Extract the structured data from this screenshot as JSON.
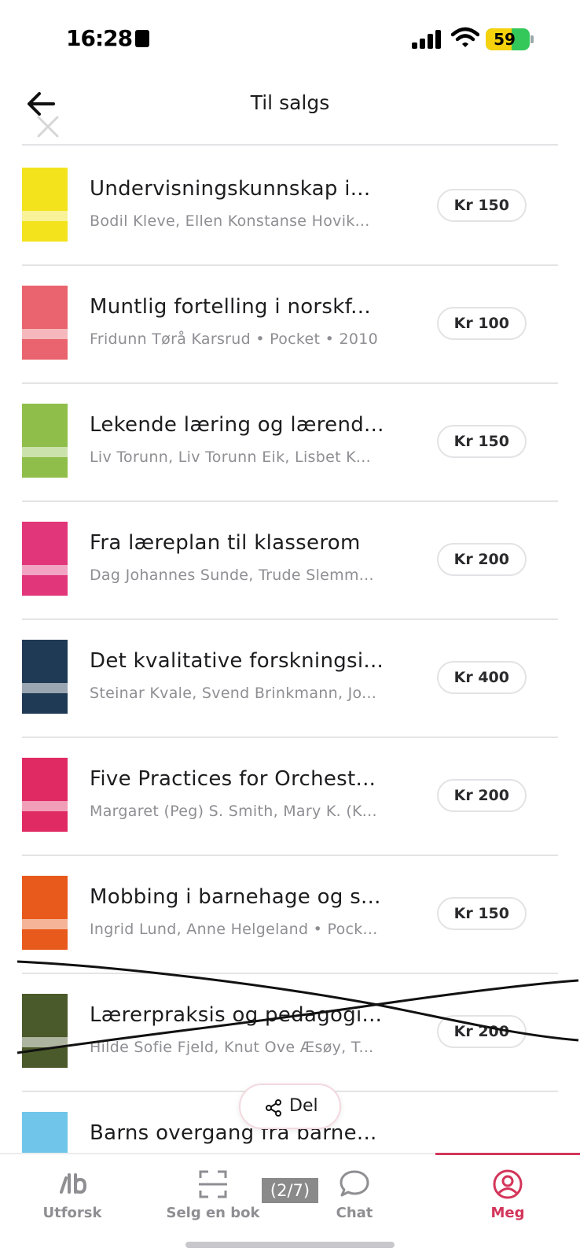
{
  "status_bar": {
    "time": "16:28",
    "battery_percent": "59"
  },
  "header": {
    "title": "Til salgs"
  },
  "books": [
    {
      "title": "Undervisningskunnskap i...",
      "subtitle": "Bodil Kleve, Ellen Konstanse Hovik...",
      "price": "Kr 150",
      "cover_color": "#f2e31c"
    },
    {
      "title": "Muntlig fortelling i norskf...",
      "subtitle": "Fridunn Tørå Karsrud • Pocket • 2010",
      "price": "Kr 100",
      "cover_color": "#e9646e"
    },
    {
      "title": "Lekende læring og lærend...",
      "subtitle": "Liv Torunn, Liv Torunn Eik, Lisbet K...",
      "price": "Kr 150",
      "cover_color": "#8fbf4a"
    },
    {
      "title": "Fra læreplan til klasserom",
      "subtitle": "Dag Johannes Sunde, Trude Slemm...",
      "price": "Kr 200",
      "cover_color": "#e2367a"
    },
    {
      "title": "Det kvalitative forskningsi...",
      "subtitle": "Steinar Kvale, Svend Brinkmann, Jo...",
      "price": "Kr 400",
      "cover_color": "#1f3a55"
    },
    {
      "title": "Five Practices for Orchest...",
      "subtitle": "Margaret (Peg) S. Smith, Mary K. (K...",
      "price": "Kr 200",
      "cover_color": "#e02a63"
    },
    {
      "title": "Mobbing i barnehage og s...",
      "subtitle": "Ingrid Lund, Anne Helgeland • Pock...",
      "price": "Kr 150",
      "cover_color": "#e8591c"
    },
    {
      "title": "Lærerpraksis og pedagogi...",
      "subtitle": "Hilde Sofie Fjeld, Knut Ove Æsøy, T...",
      "price": "Kr 200",
      "cover_color": "#4a5a2a"
    },
    {
      "title": "Barns overgang fra barne...",
      "subtitle": "",
      "price": "",
      "cover_color": "#6fc6ea"
    }
  ],
  "share": {
    "label": "Del"
  },
  "tabs": [
    {
      "label": "Utforsk",
      "icon": "logo-icon"
    },
    {
      "label": "Selg en bok",
      "icon": "scan-icon"
    },
    {
      "label": "Chat",
      "icon": "chat-icon"
    },
    {
      "label": "Meg",
      "icon": "profile-icon",
      "active": true
    }
  ],
  "page_counter": "(2/7)",
  "colors": {
    "accent": "#d3355a",
    "text_secondary": "#8e8e93",
    "divider": "#e4e4e6"
  }
}
